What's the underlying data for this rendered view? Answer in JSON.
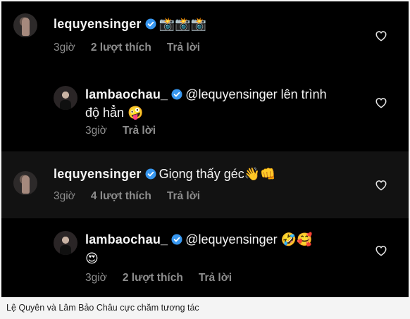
{
  "comments": [
    {
      "username": "lequyensinger",
      "text": "",
      "emoji": "📸📸📸",
      "time": "3giờ",
      "likes": "2 lượt thích",
      "reply": "Trả lời"
    },
    {
      "username": "lambaochau_",
      "text_line1": "@lequyensinger lên trình",
      "text_line2": "độ hẳn",
      "emoji": "🤪",
      "time": "3giờ",
      "reply": "Trả lời"
    },
    {
      "username": "lequyensinger",
      "text": "Giọng thấy géc",
      "emoji": "👋👊",
      "time": "3giờ",
      "likes": "4 lượt thích",
      "reply": "Trả lời"
    },
    {
      "username": "lambaochau_",
      "text": "@lequyensinger",
      "emoji": "🤣🥰",
      "emoji_line2": "😍",
      "time": "3giờ",
      "likes": "2 lượt thích",
      "reply": "Trả lời"
    }
  ],
  "caption": "Lệ Quyên và Lâm Bảo Châu cực chăm tương tác",
  "icons": {
    "verified": "verified-badge-icon",
    "like": "heart-icon"
  },
  "colors": {
    "verified_blue": "#3797f0",
    "meta_gray": "#8e8e8e"
  }
}
